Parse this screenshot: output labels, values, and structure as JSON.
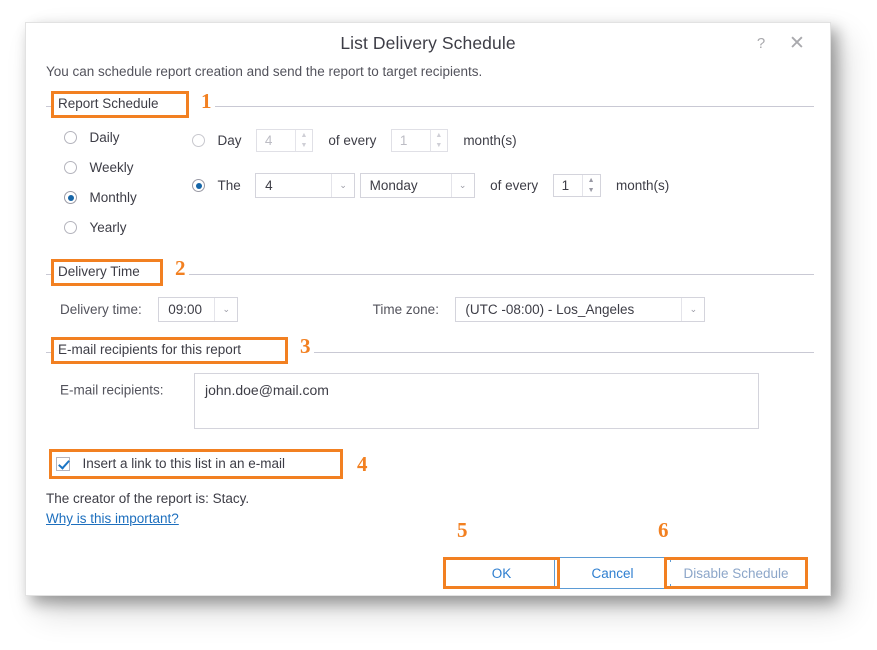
{
  "window": {
    "title": "List Delivery Schedule",
    "help_icon": "?",
    "close_icon": "✕",
    "subtitle": "You can schedule report creation and send the report to target recipients."
  },
  "sections": {
    "report_schedule": {
      "legend": "Report Schedule",
      "callout": "1",
      "frequency_options": [
        {
          "label": "Daily",
          "selected": false
        },
        {
          "label": "Weekly",
          "selected": false
        },
        {
          "label": "Monthly",
          "selected": true
        },
        {
          "label": "Yearly",
          "selected": false
        }
      ],
      "day_row": {
        "radio_label": "Day",
        "selected": false,
        "enabled": false,
        "day_value": "4",
        "of_every_label": "of every",
        "months_value": "1",
        "months_unit": "month(s)"
      },
      "the_row": {
        "radio_label": "The",
        "selected": true,
        "enabled": true,
        "ordinal_value": "4",
        "weekday_value": "Monday",
        "of_every_label": "of every",
        "months_value": "1",
        "months_unit": "month(s)"
      }
    },
    "delivery_time": {
      "legend": "Delivery Time",
      "callout": "2",
      "time_label": "Delivery time:",
      "time_value": "09:00",
      "timezone_label": "Time zone:",
      "timezone_value": "(UTC -08:00) - Los_Angeles"
    },
    "recipients": {
      "legend": "E-mail recipients for this report",
      "callout": "3",
      "field_label": "E-mail recipients:",
      "field_value": "john.doe@mail.com"
    },
    "insert_link": {
      "checkbox_label": "Insert a link to this list in an e-mail",
      "checked": true,
      "callout": "4"
    },
    "creator": {
      "text": "The creator of the report is: Stacy.",
      "link": "Why is this important?"
    }
  },
  "footer": {
    "ok_label": "OK",
    "ok_callout": "5",
    "cancel_label": "Cancel",
    "disable_label": "Disable Schedule",
    "disable_callout": "6"
  },
  "colors": {
    "callout_orange": "#f28021",
    "accent_blue": "#2f7fd0",
    "radio_blue": "#1565a7",
    "link_blue": "#1d6fbe",
    "text": "#3d3d46",
    "border": "#d4d4dc"
  },
  "icons": {
    "spin_up": "▲",
    "spin_down": "▼",
    "chevron_down": "⌄"
  }
}
